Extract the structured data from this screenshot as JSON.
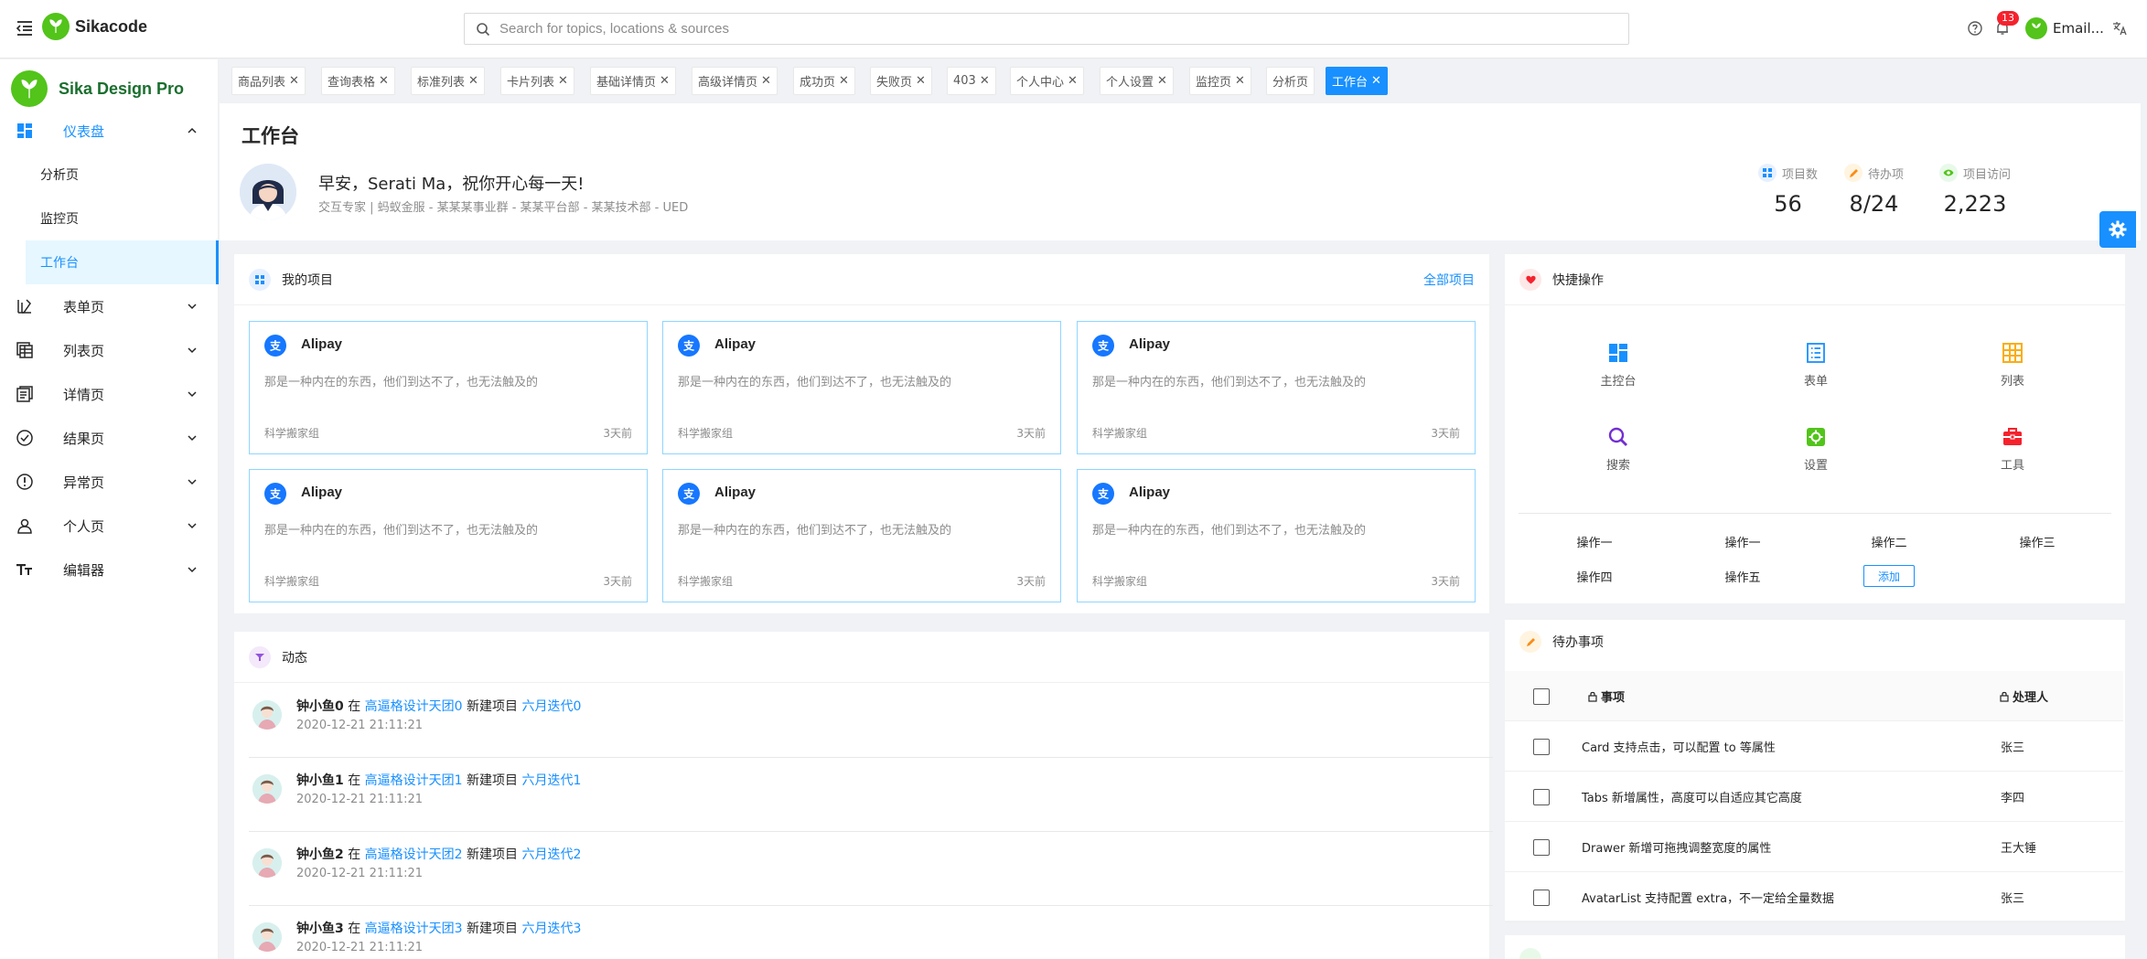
{
  "header": {
    "logo_text": "Sikacode",
    "search_placeholder": "Search for topics, locations & sources",
    "notification_count": "13",
    "user_name": "Email..."
  },
  "sidebar": {
    "brand": "Sika Design Pro",
    "dashboard_label": "仪表盘",
    "sub_items": [
      "分析页",
      "监控页",
      "工作台"
    ],
    "items": [
      "表单页",
      "列表页",
      "详情页",
      "结果页",
      "异常页",
      "个人页",
      "编辑器"
    ]
  },
  "tabs": [
    "商品列表",
    "查询表格",
    "标准列表",
    "卡片列表",
    "基础详情页",
    "高级详情页",
    "成功页",
    "失败页",
    "403",
    "个人中心",
    "个人设置",
    "监控页",
    "分析页",
    "工作台"
  ],
  "page": {
    "title": "工作台",
    "greeting": "早安，Serati Ma，祝你开心每一天!",
    "subtitle": "交互专家 | 蚂蚁金服 - 某某某事业群 - 某某平台部 - 某某技术部 - UED",
    "stats": [
      {
        "label": "项目数",
        "value": "56"
      },
      {
        "label": "待办项",
        "value": "8/24"
      },
      {
        "label": "项目访问",
        "value": "2,223"
      }
    ]
  },
  "projects": {
    "title": "我的项目",
    "all_link": "全部项目",
    "items": [
      {
        "name": "Alipay",
        "desc": "那是一种内在的东西，他们到达不了，也无法触及的",
        "team": "科学搬家组",
        "time": "3天前"
      },
      {
        "name": "Alipay",
        "desc": "那是一种内在的东西，他们到达不了，也无法触及的",
        "team": "科学搬家组",
        "time": "3天前"
      },
      {
        "name": "Alipay",
        "desc": "那是一种内在的东西，他们到达不了，也无法触及的",
        "team": "科学搬家组",
        "time": "3天前"
      },
      {
        "name": "Alipay",
        "desc": "那是一种内在的东西，他们到达不了，也无法触及的",
        "team": "科学搬家组",
        "time": "3天前"
      },
      {
        "name": "Alipay",
        "desc": "那是一种内在的东西，他们到达不了，也无法触及的",
        "team": "科学搬家组",
        "time": "3天前"
      },
      {
        "name": "Alipay",
        "desc": "那是一种内在的东西，他们到达不了，也无法触及的",
        "team": "科学搬家组",
        "time": "3天前"
      }
    ]
  },
  "activity": {
    "title": "动态",
    "connector_in": "在",
    "connector_action": "新建项目",
    "items": [
      {
        "user": "钟小鱼0",
        "group": "高逼格设计天团0",
        "project": "六月迭代0",
        "time": "2020-12-21 21:11:21"
      },
      {
        "user": "钟小鱼1",
        "group": "高逼格设计天团1",
        "project": "六月迭代1",
        "time": "2020-12-21 21:11:21"
      },
      {
        "user": "钟小鱼2",
        "group": "高逼格设计天团2",
        "project": "六月迭代2",
        "time": "2020-12-21 21:11:21"
      },
      {
        "user": "钟小鱼3",
        "group": "高逼格设计天团3",
        "project": "六月迭代3",
        "time": "2020-12-21 21:11:21"
      }
    ]
  },
  "quick": {
    "title": "快捷操作",
    "actions": [
      "主控台",
      "表单",
      "列表",
      "搜索",
      "设置",
      "工具"
    ],
    "links": [
      "操作一",
      "操作一",
      "操作二",
      "操作三",
      "操作四",
      "操作五"
    ],
    "add_label": "添加"
  },
  "todo": {
    "title": "待办事项",
    "col_task": "事项",
    "col_owner": "处理人",
    "rows": [
      {
        "task": "Card 支持点击，可以配置 to 等属性",
        "owner": "张三"
      },
      {
        "task": "Tabs 新增属性，高度可以自适应其它高度",
        "owner": "李四"
      },
      {
        "task": "Drawer 新增可拖拽调整宽度的属性",
        "owner": "王大锤"
      },
      {
        "task": "AvatarList 支持配置 extra，不一定给全量数据",
        "owner": "张三"
      }
    ]
  },
  "colors": {
    "primary": "#1890ff",
    "brand_green": "#52c41a",
    "bg": "#f0f2f5"
  }
}
